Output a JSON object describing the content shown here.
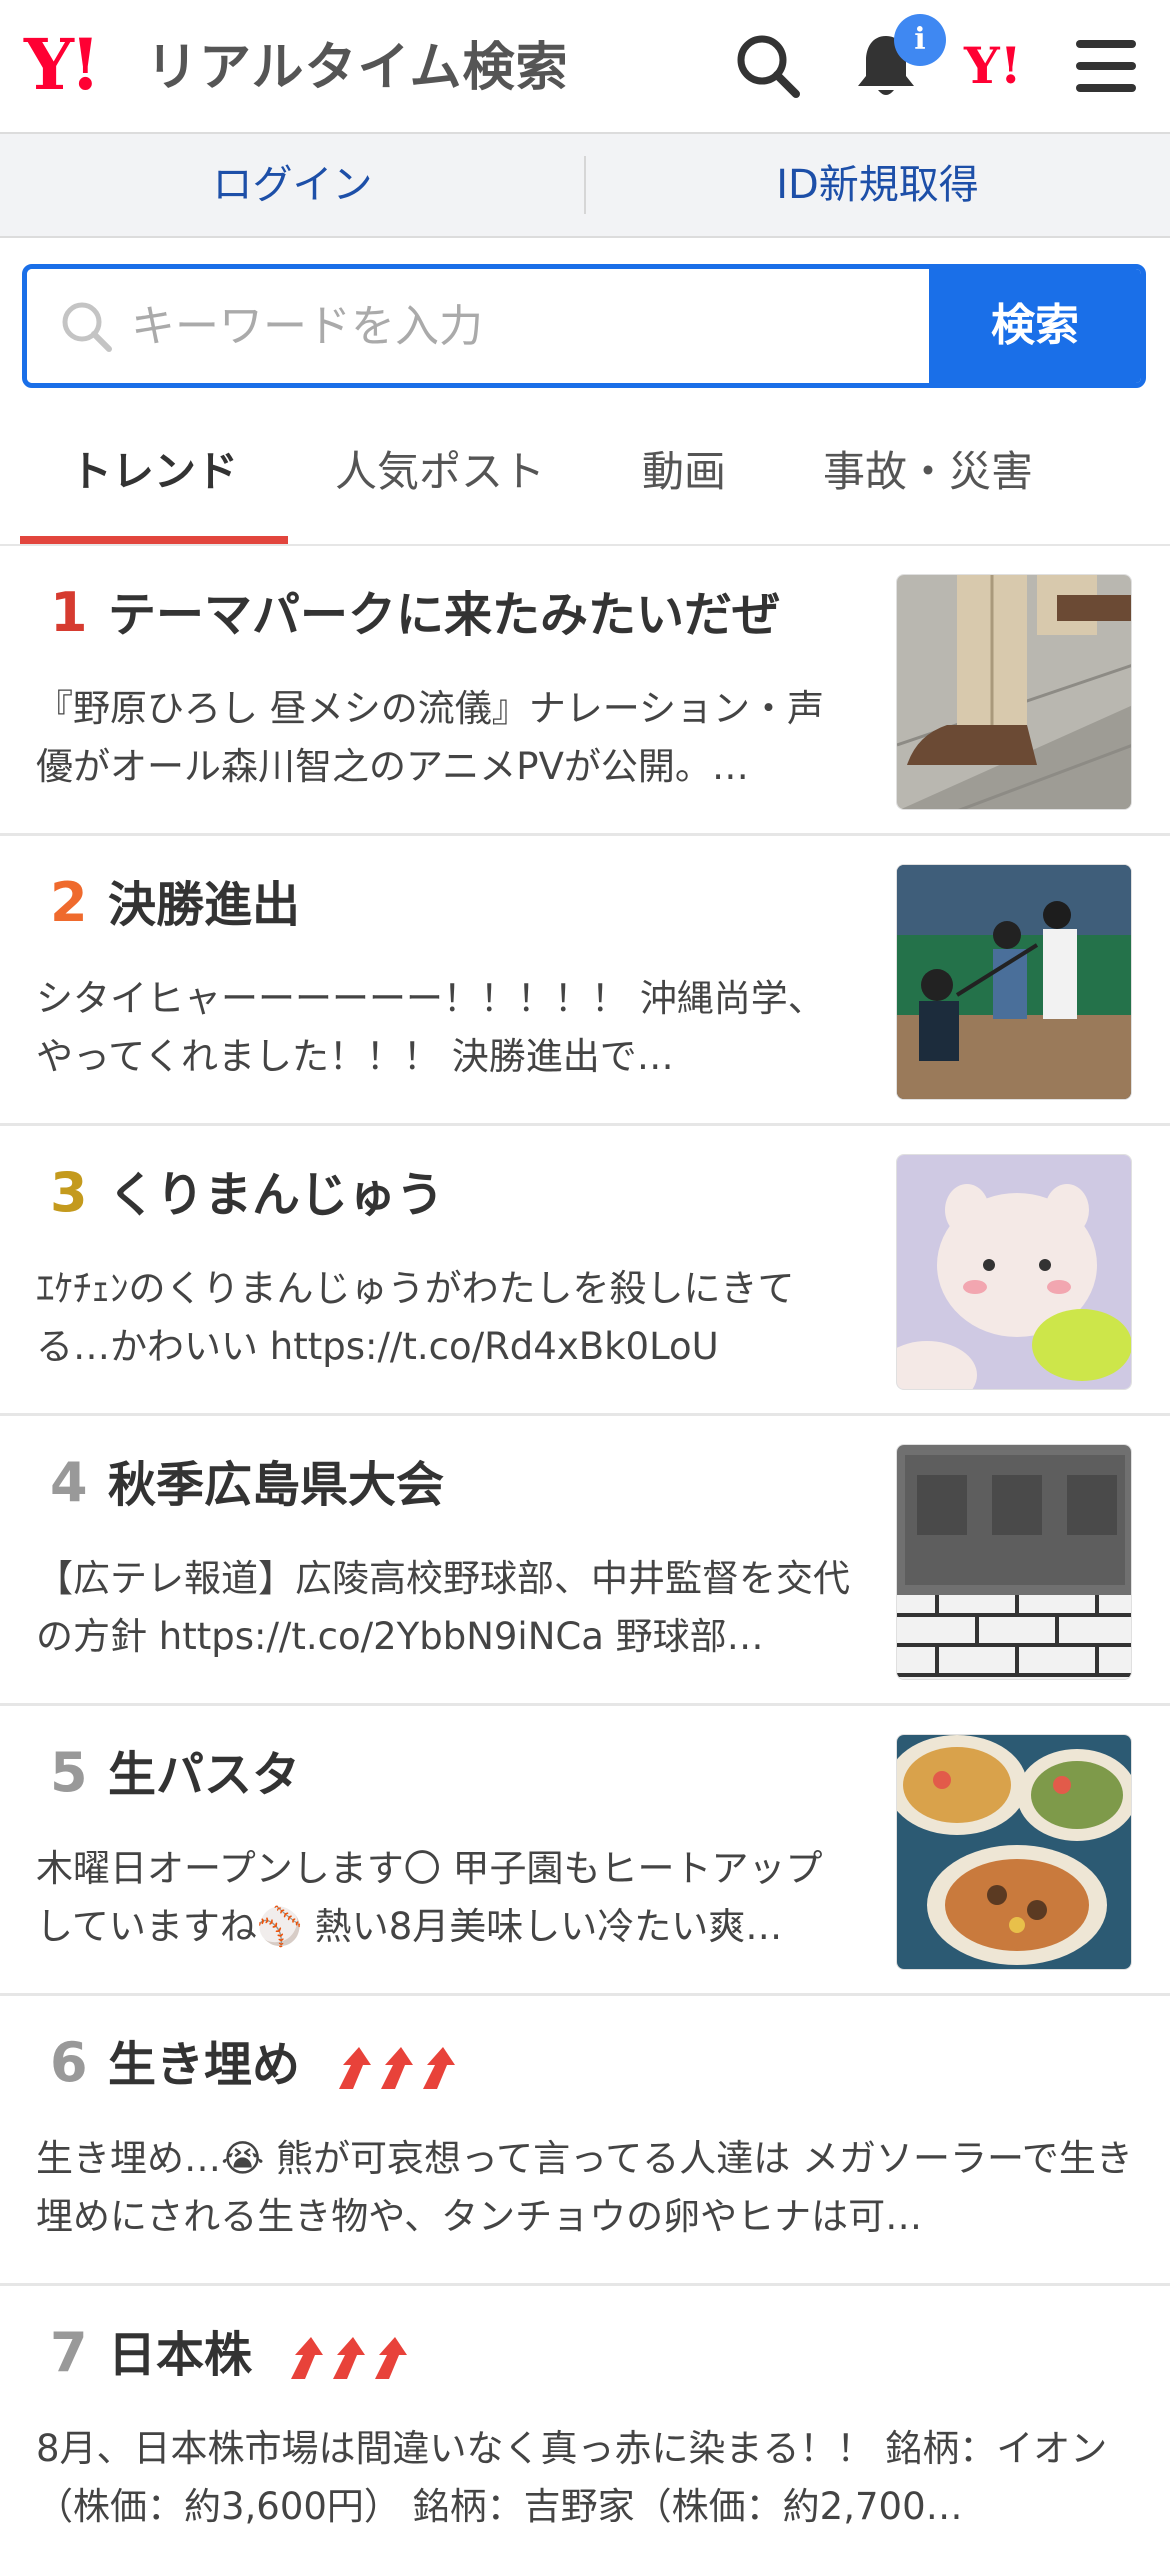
{
  "header": {
    "logo_mark": "Y!",
    "logo_text": "リアルタイム検索",
    "notification_badge": "i",
    "brand_mark": "Y!"
  },
  "login_bar": {
    "login_label": "ログイン",
    "signup_label": "ID新規取得"
  },
  "search": {
    "placeholder": "キーワードを入力",
    "button_label": "検索"
  },
  "tabs": [
    {
      "label": "トレンド",
      "active": true
    },
    {
      "label": "人気ポスト",
      "active": false
    },
    {
      "label": "動画",
      "active": false
    },
    {
      "label": "事故・災害",
      "active": false
    }
  ],
  "colors": {
    "brand_red": "#ff0033",
    "accent_blue": "#1a6fe8",
    "rank_1": "#d63b30",
    "rank_2": "#ef6a2d",
    "rank_3": "#c49a1d",
    "rank_other": "#999999",
    "trend_arrow": "#e8423a"
  },
  "trends": [
    {
      "rank": "1",
      "title": "テーマパークに来たみたいだぜ",
      "desc": "『野原ひろし 昼メシの流儀』ナレーション・声優がオール森川智之のアニメPVが公開。…",
      "thumb_icon": "anime-legs-thumbnail",
      "rising": false
    },
    {
      "rank": "2",
      "title": "決勝進出",
      "desc": "シタイヒャーーーーーー！！！！！ 沖縄尚学、やってくれました！！！ 決勝進出で…",
      "thumb_icon": "baseball-batter-thumbnail",
      "rising": false
    },
    {
      "rank": "3",
      "title": "くりまんじゅう",
      "desc": "ｴｹﾁｪﾝのくりまんじゅうがわたしを殺しにきてる…かわいい https://t.co/Rd4xBk0LoU",
      "thumb_icon": "plush-toy-thumbnail",
      "rising": false
    },
    {
      "rank": "4",
      "title": "秋季広島県大会",
      "desc": "【広テレ報道】広陵高校野球部、中井監督を交代の方針 https://t.co/2YbbN9iNCa 野球部…",
      "thumb_icon": "school-sign-thumbnail",
      "rising": false
    },
    {
      "rank": "5",
      "title": "生パスタ",
      "desc": "木曜日オープンします〇 甲子園もヒートアップしていますね⚾ 熱い8月美味しい冷たい爽…",
      "thumb_icon": "pasta-dish-thumbnail",
      "rising": false
    },
    {
      "rank": "6",
      "title": "生き埋め",
      "desc": "生き埋め…😭 熊が可哀想って言ってる人達は メガソーラーで生き埋めにされる生き物や、タンチョウの卵やヒナは可…",
      "thumb_icon": "",
      "rising": true
    },
    {
      "rank": "7",
      "title": "日本株",
      "desc": "8月、日本株市場は間違いなく真っ赤に染まる！！ 銘柄：イオン（株価：約3,600円） 銘柄：吉野家（株価：約2,700…",
      "thumb_icon": "",
      "rising": true
    }
  ]
}
